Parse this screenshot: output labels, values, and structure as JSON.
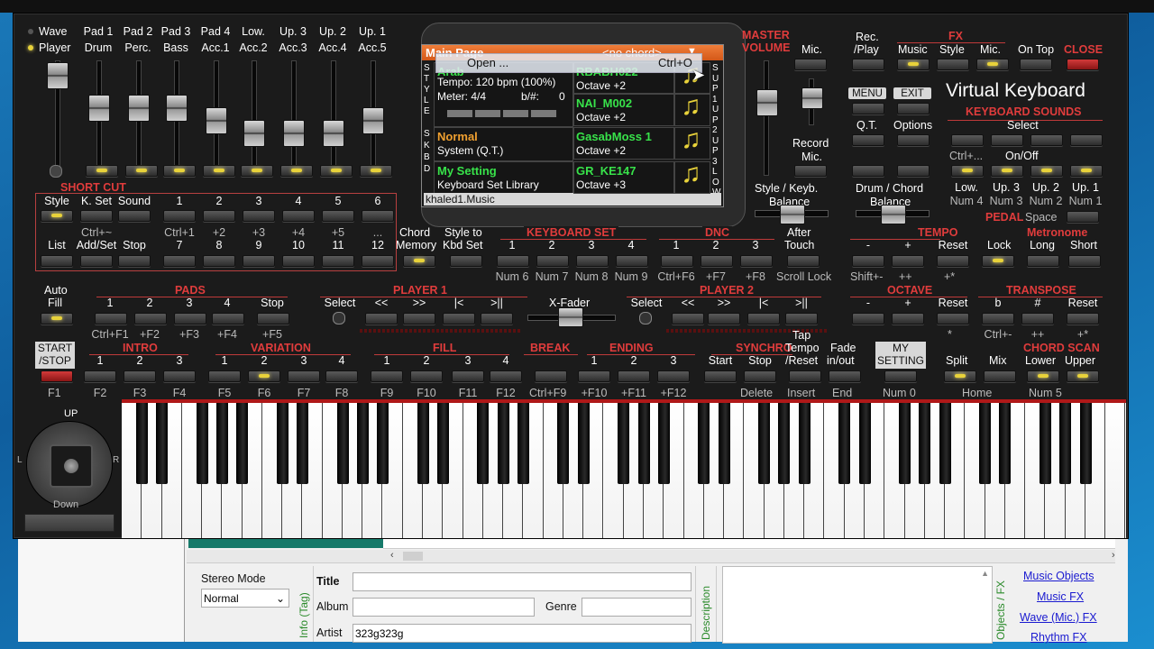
{
  "left_fader_labels": [
    {
      "top": "Pad 1",
      "bot": "Drum"
    },
    {
      "top": "Pad 2",
      "bot": "Perc."
    },
    {
      "top": "Pad 3",
      "bot": "Bass"
    },
    {
      "top": "Pad 4",
      "bot": "Acc.1"
    },
    {
      "top": "Low.",
      "bot": "Acc.2"
    },
    {
      "top": "Up. 3",
      "bot": "Acc.3"
    },
    {
      "top": "Up. 2",
      "bot": "Acc.4"
    },
    {
      "top": "Up. 1",
      "bot": "Acc.5"
    }
  ],
  "wave_player": {
    "wave": "Wave",
    "player": "Player"
  },
  "shortcut": {
    "title": "SHORT CUT",
    "row1": [
      "Style",
      "K. Set",
      "Sound",
      "1",
      "2",
      "3",
      "4",
      "5",
      "6"
    ],
    "row2_hint": [
      "Ctrl+~",
      "Ctrl+1",
      "+2",
      "+3",
      "+4",
      "+5",
      "..."
    ],
    "row3": [
      "List",
      "Add/Set",
      "Stop",
      "7",
      "8",
      "9",
      "10",
      "11",
      "12"
    ]
  },
  "display": {
    "title": "Main Page",
    "chord": "<no chord>",
    "style_letters": "STYLE",
    "skbd_letters": "SKBD",
    "sup_letters": "SUP1UP2UP3LOW",
    "menu_open": "Open ...",
    "menu_shortcut": "Ctrl+O",
    "style_name": "Arab",
    "tempo": "Tempo: 120 bpm (100%)",
    "meter": "Meter: 4/4",
    "bsharp": "b/#:",
    "bsharp_val": "0",
    "normal": "Normal",
    "system": "System (Q.T.)",
    "mysetting": "My Setting",
    "ksetlib": "Keyboard Set Library",
    "footer": "khaled1.Music",
    "sounds": [
      {
        "name": "RBABH022",
        "oct": "Octave +2"
      },
      {
        "name": "NAI_M002",
        "oct": "Octave +2"
      },
      {
        "name": "GasabMoss 1",
        "oct": "Octave +2"
      },
      {
        "name": "GR_KE147",
        "oct": "Octave +3"
      }
    ]
  },
  "master": {
    "title1": "MASTER",
    "title2": "VOLUME",
    "mic": "Mic.",
    "record": "Record",
    "record2": "Mic.",
    "style_kbd": "Style / Keyb.",
    "balance": "Balance"
  },
  "rec": {
    "l1": "Rec.",
    "l2": "/Play"
  },
  "fx": {
    "title": "FX",
    "items": [
      "Music",
      "Style",
      "Mic."
    ]
  },
  "ontop": "On Top",
  "close": "CLOSE",
  "menu": "MENU",
  "exit": "EXIT",
  "qt": "Q.T.",
  "options": "Options",
  "drumchord": "Drum / Chord",
  "balance2": "Balance",
  "app_title": "Virtual Keyboard",
  "kbd_sounds": {
    "title": "KEYBOARD SOUNDS",
    "select": "Select",
    "ctrl": "Ctrl+...",
    "onoff": "On/Off",
    "items": [
      "Low.",
      "Up. 3",
      "Up. 2",
      "Up. 1"
    ],
    "nums": [
      "Num 4",
      "Num 3",
      "Num 2",
      "Num 1"
    ]
  },
  "pedal": "PEDAL",
  "space": "Space",
  "chord_memory": {
    "l1": "Chord",
    "l2": "Memory"
  },
  "style_to": {
    "l1": "Style to",
    "l2": "Kbd Set"
  },
  "kbd_set": {
    "title": "KEYBOARD SET",
    "items": [
      "1",
      "2",
      "3",
      "4"
    ],
    "keys": [
      "Num 6",
      "Num 7",
      "Num 8",
      "Num 9"
    ]
  },
  "dnc": {
    "title": "DNC",
    "items": [
      "1",
      "2",
      "3"
    ],
    "keys": [
      "Ctrl+F6",
      "+F7",
      "+F8"
    ]
  },
  "after_touch": {
    "l1": "After",
    "l2": "Touch",
    "key": "Scroll Lock"
  },
  "tempo": {
    "title": "TEMPO",
    "items": [
      "-",
      "+",
      "Reset"
    ],
    "keys": [
      "Shift+-",
      "++",
      "+*"
    ]
  },
  "lock": "Lock",
  "metronome": {
    "title": "Metronome",
    "items": [
      "Long",
      "Short"
    ]
  },
  "auto_fill": {
    "l1": "Auto",
    "l2": "Fill"
  },
  "pads": {
    "title": "PADS",
    "items": [
      "1",
      "2",
      "3",
      "4",
      "Stop"
    ],
    "keys": [
      "Ctrl+F1",
      "+F2",
      "+F3",
      "+F4",
      "+F5"
    ]
  },
  "player1": {
    "title": "PLAYER 1",
    "items": [
      "Select",
      "<<",
      ">>",
      "|<",
      ">||"
    ]
  },
  "xfader": "X-Fader",
  "player2": {
    "title": "PLAYER 2",
    "items": [
      "Select",
      "<<",
      ">>",
      "|<",
      ">||"
    ]
  },
  "octave": {
    "title": "OCTAVE",
    "items": [
      "-",
      "+",
      "Reset"
    ]
  },
  "transpose": {
    "title": "TRANSPOSE",
    "items": [
      "b",
      "#",
      "Reset"
    ],
    "keys": [
      "Ctrl+-",
      "++",
      "+*"
    ]
  },
  "star": "*",
  "start_stop": {
    "l1": "START",
    "l2": "/STOP",
    "key": "F1"
  },
  "intro": {
    "title": "INTRO",
    "items": [
      "1",
      "2",
      "3"
    ],
    "keys": [
      "F2",
      "F3",
      "F4"
    ]
  },
  "variation": {
    "title": "VARIATION",
    "items": [
      "1",
      "2",
      "3",
      "4"
    ],
    "keys": [
      "F5",
      "F6",
      "F7",
      "F8"
    ]
  },
  "fill": {
    "title": "FILL",
    "items": [
      "1",
      "2",
      "3",
      "4"
    ],
    "keys": [
      "F9",
      "F10",
      "F11",
      "F12"
    ]
  },
  "break": {
    "title": "BREAK",
    "key": "Ctrl+F9"
  },
  "ending": {
    "title": "ENDING",
    "items": [
      "1",
      "2",
      "3"
    ],
    "keys": [
      "+F10",
      "+F11",
      "+F12"
    ]
  },
  "synchro": {
    "title": "SYNCHRO",
    "items": [
      "Start",
      "Stop"
    ],
    "keys": [
      "Delete"
    ]
  },
  "tap": {
    "l1": "Tap",
    "l2": "Tempo",
    "l3": "/Reset",
    "key": "Insert"
  },
  "fade": {
    "l1": "Fade",
    "l2": "in/out",
    "key": "End"
  },
  "mysetting_btn": {
    "l1": "MY",
    "l2": "SETTING",
    "key": "Num 0"
  },
  "split": "Split",
  "mix": "Mix",
  "home": "Home",
  "chord_scan": {
    "title": "CHORD SCAN",
    "items": [
      "Lower",
      "Upper"
    ],
    "key": "Num 5"
  },
  "joystick": {
    "up": "UP",
    "down": "Down",
    "l": "L",
    "r": "R"
  },
  "lower": {
    "stereo_label": "Stereo Mode",
    "stereo_value": "Normal",
    "info_tag": "Info (Tag)",
    "title": "Title",
    "album": "Album",
    "genre": "Genre",
    "artist": "Artist",
    "artist_value": "323g323g",
    "description": "Description",
    "objects_fx": "Objects / FX",
    "links": [
      "Music Objects",
      "Music FX",
      "Wave (Mic.) FX",
      "Rhythm FX"
    ]
  }
}
